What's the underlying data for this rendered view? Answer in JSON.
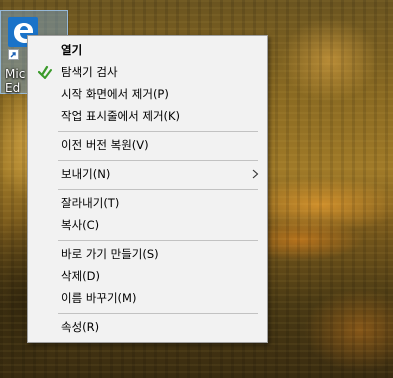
{
  "desktop": {
    "icon": {
      "label": "Mic\nEd",
      "icon": "edge-icon",
      "overlay": "shortcut-arrow-icon"
    }
  },
  "context_menu": {
    "groups": [
      [
        {
          "label": "열기",
          "bold": true
        },
        {
          "label": "탐색기 검사",
          "icon": "defender-scan-icon"
        },
        {
          "label": "시작 화면에서 제거(P)"
        },
        {
          "label": "작업 표시줄에서 제거(K)"
        }
      ],
      [
        {
          "label": "이전 버전 복원(V)"
        }
      ],
      [
        {
          "label": "보내기(N)",
          "submenu": true
        }
      ],
      [
        {
          "label": "잘라내기(T)"
        },
        {
          "label": "복사(C)"
        }
      ],
      [
        {
          "label": "바로 가기 만들기(S)"
        },
        {
          "label": "삭제(D)"
        },
        {
          "label": "이름 바꾸기(M)"
        }
      ],
      [
        {
          "label": "속성(R)"
        }
      ]
    ]
  },
  "colors": {
    "menu_background": "#f2f2f2",
    "menu_border": "#a0a0a0",
    "separator": "#c2c2c2",
    "icon_selection": "#7aaadc",
    "edge_blue": "#1a73c9",
    "defender_green": "#3a9a2a"
  }
}
